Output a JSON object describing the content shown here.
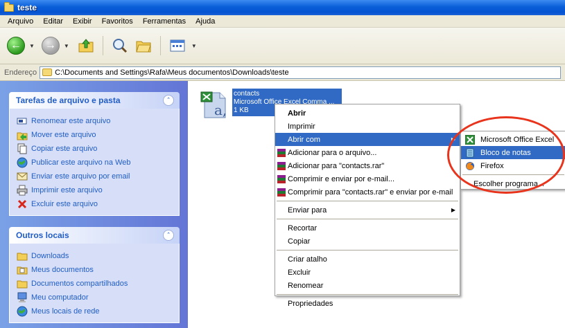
{
  "window": {
    "title": "teste"
  },
  "menubar": {
    "items": [
      "Arquivo",
      "Editar",
      "Exibir",
      "Favoritos",
      "Ferramentas",
      "Ajuda"
    ]
  },
  "address": {
    "label": "Endereço",
    "path": "C:\\Documents and Settings\\Rafa\\Meus documentos\\Downloads\\teste"
  },
  "tasks_panel": {
    "title": "Tarefas de arquivo e pasta",
    "items": [
      {
        "label": "Renomear este arquivo",
        "icon": "rename-icon"
      },
      {
        "label": "Mover este arquivo",
        "icon": "move-icon"
      },
      {
        "label": "Copiar este arquivo",
        "icon": "copy-icon"
      },
      {
        "label": "Publicar este arquivo na Web",
        "icon": "web-publish-icon"
      },
      {
        "label": "Enviar este arquivo por email",
        "icon": "email-icon"
      },
      {
        "label": "Imprimir este arquivo",
        "icon": "print-icon"
      },
      {
        "label": "Excluir este arquivo",
        "icon": "delete-icon"
      }
    ]
  },
  "places_panel": {
    "title": "Outros locais",
    "items": [
      {
        "label": "Downloads",
        "icon": "folder-icon"
      },
      {
        "label": "Meus documentos",
        "icon": "my-documents-icon"
      },
      {
        "label": "Documentos compartilhados",
        "icon": "shared-folder-icon"
      },
      {
        "label": "Meu computador",
        "icon": "computer-icon"
      },
      {
        "label": "Meus locais de rede",
        "icon": "network-icon"
      }
    ]
  },
  "file": {
    "name": "contacts",
    "type": "Microsoft Office Excel Comma ...",
    "size": "1 KB"
  },
  "context_menu": {
    "open": "Abrir",
    "print": "Imprimir",
    "open_with": "Abrir com",
    "add_archive": "Adicionar para o arquivo...",
    "add_rar": "Adicionar para \"contacts.rar\"",
    "compress_email": "Comprimir e enviar por e-mail...",
    "compress_rar_email": "Comprimir para \"contacts.rar\" e enviar por e-mail",
    "send_to": "Enviar para",
    "cut": "Recortar",
    "copy": "Copiar",
    "shortcut": "Criar atalho",
    "delete": "Excluir",
    "rename": "Renomear",
    "properties": "Propriedades"
  },
  "open_with_menu": {
    "excel": "Microsoft Office Excel",
    "notepad": "Bloco de notas",
    "firefox": "Firefox",
    "choose": "Escolher programa..."
  },
  "colors": {
    "highlight": "#316ac5",
    "task_link": "#215dc6",
    "annotation_ring": "#e8341c"
  }
}
